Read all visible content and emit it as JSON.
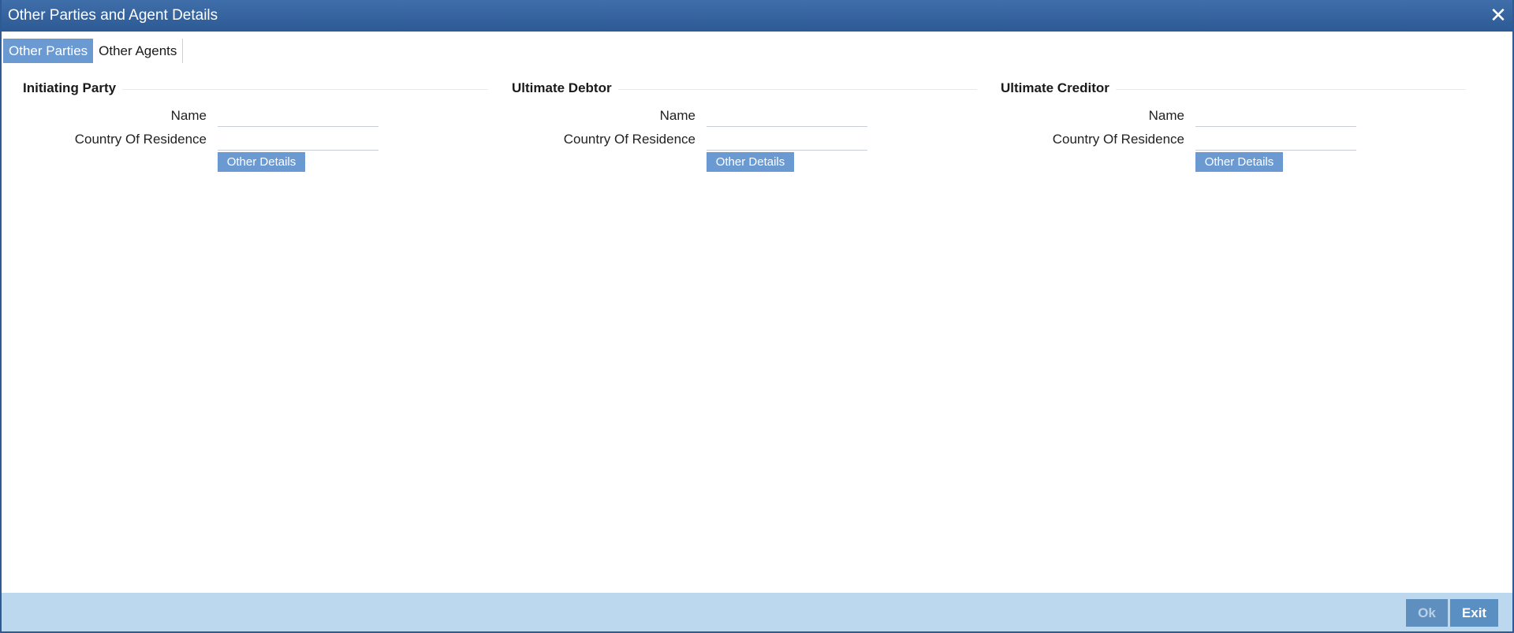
{
  "window": {
    "title": "Other Parties and Agent Details",
    "close_label": "✕"
  },
  "tabs": [
    {
      "label": "Other Parties",
      "active": true
    },
    {
      "label": "Other Agents",
      "active": false
    }
  ],
  "sections": [
    {
      "title": "Initiating Party",
      "name_label": "Name",
      "name_value": "",
      "country_label": "Country Of Residence",
      "country_value": "",
      "button_label": "Other Details"
    },
    {
      "title": "Ultimate Debtor",
      "name_label": "Name",
      "name_value": "",
      "country_label": "Country Of Residence",
      "country_value": "",
      "button_label": "Other Details"
    },
    {
      "title": "Ultimate Creditor",
      "name_label": "Name",
      "name_value": "",
      "country_label": "Country Of Residence",
      "country_value": "",
      "button_label": "Other Details"
    }
  ],
  "footer": {
    "ok_label": "Ok",
    "ok_enabled": false,
    "exit_label": "Exit"
  },
  "colors": {
    "titlebar": "#2f5b94",
    "accent": "#6b9ad3",
    "footer_bg": "#bcd8ee",
    "footer_button": "#5a8fc4"
  },
  "icons": {
    "close": "close-icon"
  }
}
